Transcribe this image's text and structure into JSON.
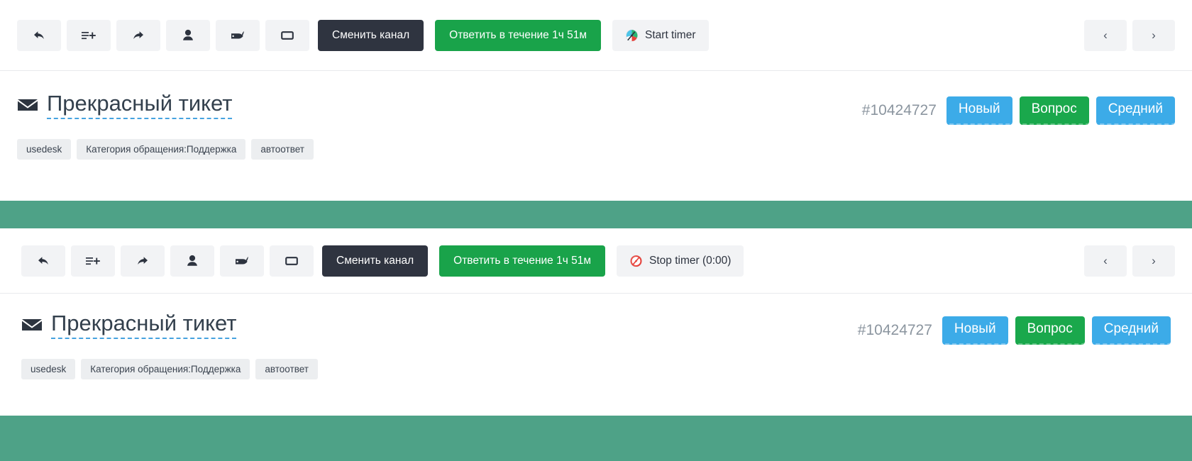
{
  "toolbar": {
    "icons": [
      {
        "name": "reply-icon",
        "label": "Ответить"
      },
      {
        "name": "note-add-icon",
        "label": "Добавить заметку"
      },
      {
        "name": "forward-icon",
        "label": "Переслать"
      },
      {
        "name": "assign-user-icon",
        "label": "Назначить"
      },
      {
        "name": "tag-icon",
        "label": "Теги"
      },
      {
        "name": "comment-icon",
        "label": "Комментарий"
      }
    ],
    "change_channel_label": "Сменить канал",
    "reply_deadline_label": "Ответить в течение 1ч 51м",
    "timer_start_label": "Start timer",
    "timer_stop_label": "Stop timer (0:00)",
    "prev_label": "‹",
    "next_label": "›"
  },
  "ticket": {
    "title": "Прекрасный тикет",
    "number": "#10424727",
    "status_badge": "Новый",
    "type_badge": "Вопрос",
    "priority_badge": "Средний",
    "tags": [
      "usedesk",
      "Категория обращения:Поддержка",
      "автоответ"
    ]
  },
  "colors": {
    "dark_button": "#2f3440",
    "green_button": "#19a34a",
    "badge_blue": "#3cabe8",
    "badge_green": "#1aa84c",
    "band_green": "#4ea287",
    "toolbar_button": "#f2f3f5",
    "title_text": "#33404d",
    "ticket_number": "#8b959f",
    "tag_bg": "#eceef0",
    "dashed_underline": "#46a3e0"
  }
}
